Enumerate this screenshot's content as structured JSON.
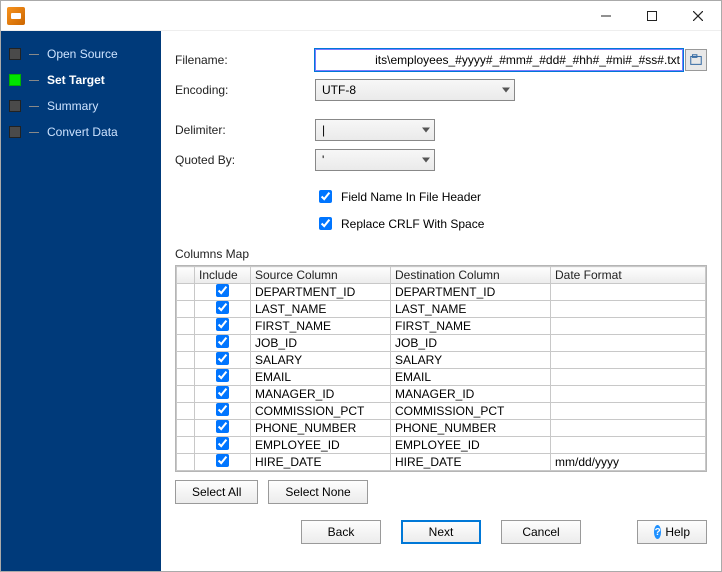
{
  "sidebar": {
    "items": [
      {
        "label": "Open Source",
        "active": false
      },
      {
        "label": "Set Target",
        "active": true
      },
      {
        "label": "Summary",
        "active": false
      },
      {
        "label": "Convert Data",
        "active": false
      }
    ]
  },
  "form": {
    "filename_label": "Filename:",
    "filename_value": "its\\employees_#yyyy#_#mm#_#dd#_#hh#_#mi#_#ss#.txt",
    "encoding_label": "Encoding:",
    "encoding_value": "UTF-8",
    "delimiter_label": "Delimiter:",
    "delimiter_value": "|",
    "quoted_label": "Quoted By:",
    "quoted_value": "'",
    "field_header_label": "Field Name In File Header",
    "replace_crlf_label": "Replace CRLF With Space"
  },
  "columns_map": {
    "title": "Columns Map",
    "headers": {
      "include": "Include",
      "source": "Source Column",
      "destination": "Destination Column",
      "date_format": "Date Format"
    },
    "rows": [
      {
        "include": true,
        "source": "DEPARTMENT_ID",
        "destination": "DEPARTMENT_ID",
        "date_format": ""
      },
      {
        "include": true,
        "source": "LAST_NAME",
        "destination": "LAST_NAME",
        "date_format": ""
      },
      {
        "include": true,
        "source": "FIRST_NAME",
        "destination": "FIRST_NAME",
        "date_format": ""
      },
      {
        "include": true,
        "source": "JOB_ID",
        "destination": "JOB_ID",
        "date_format": ""
      },
      {
        "include": true,
        "source": "SALARY",
        "destination": "SALARY",
        "date_format": ""
      },
      {
        "include": true,
        "source": "EMAIL",
        "destination": "EMAIL",
        "date_format": ""
      },
      {
        "include": true,
        "source": "MANAGER_ID",
        "destination": "MANAGER_ID",
        "date_format": ""
      },
      {
        "include": true,
        "source": "COMMISSION_PCT",
        "destination": "COMMISSION_PCT",
        "date_format": ""
      },
      {
        "include": true,
        "source": "PHONE_NUMBER",
        "destination": "PHONE_NUMBER",
        "date_format": ""
      },
      {
        "include": true,
        "source": "EMPLOYEE_ID",
        "destination": "EMPLOYEE_ID",
        "date_format": ""
      },
      {
        "include": true,
        "source": "HIRE_DATE",
        "destination": "HIRE_DATE",
        "date_format": "mm/dd/yyyy"
      }
    ]
  },
  "buttons": {
    "select_all": "Select All",
    "select_none": "Select None",
    "back": "Back",
    "next": "Next",
    "cancel": "Cancel",
    "help": "Help"
  }
}
